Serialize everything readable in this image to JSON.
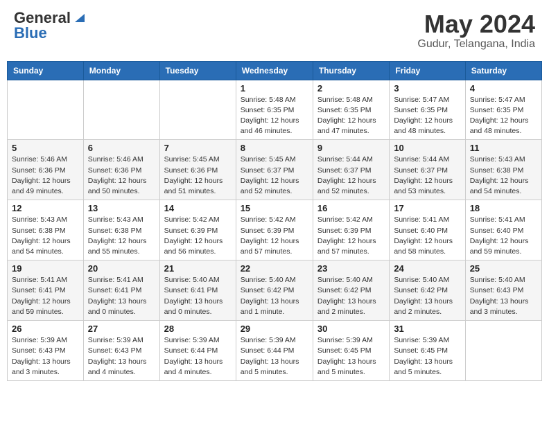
{
  "logo": {
    "general": "General",
    "blue": "Blue"
  },
  "header": {
    "month_year": "May 2024",
    "location": "Gudur, Telangana, India"
  },
  "days_of_week": [
    "Sunday",
    "Monday",
    "Tuesday",
    "Wednesday",
    "Thursday",
    "Friday",
    "Saturday"
  ],
  "weeks": [
    [
      {
        "day": "",
        "info": ""
      },
      {
        "day": "",
        "info": ""
      },
      {
        "day": "",
        "info": ""
      },
      {
        "day": "1",
        "info": "Sunrise: 5:48 AM\nSunset: 6:35 PM\nDaylight: 12 hours\nand 46 minutes."
      },
      {
        "day": "2",
        "info": "Sunrise: 5:48 AM\nSunset: 6:35 PM\nDaylight: 12 hours\nand 47 minutes."
      },
      {
        "day": "3",
        "info": "Sunrise: 5:47 AM\nSunset: 6:35 PM\nDaylight: 12 hours\nand 48 minutes."
      },
      {
        "day": "4",
        "info": "Sunrise: 5:47 AM\nSunset: 6:35 PM\nDaylight: 12 hours\nand 48 minutes."
      }
    ],
    [
      {
        "day": "5",
        "info": "Sunrise: 5:46 AM\nSunset: 6:36 PM\nDaylight: 12 hours\nand 49 minutes."
      },
      {
        "day": "6",
        "info": "Sunrise: 5:46 AM\nSunset: 6:36 PM\nDaylight: 12 hours\nand 50 minutes."
      },
      {
        "day": "7",
        "info": "Sunrise: 5:45 AM\nSunset: 6:36 PM\nDaylight: 12 hours\nand 51 minutes."
      },
      {
        "day": "8",
        "info": "Sunrise: 5:45 AM\nSunset: 6:37 PM\nDaylight: 12 hours\nand 52 minutes."
      },
      {
        "day": "9",
        "info": "Sunrise: 5:44 AM\nSunset: 6:37 PM\nDaylight: 12 hours\nand 52 minutes."
      },
      {
        "day": "10",
        "info": "Sunrise: 5:44 AM\nSunset: 6:37 PM\nDaylight: 12 hours\nand 53 minutes."
      },
      {
        "day": "11",
        "info": "Sunrise: 5:43 AM\nSunset: 6:38 PM\nDaylight: 12 hours\nand 54 minutes."
      }
    ],
    [
      {
        "day": "12",
        "info": "Sunrise: 5:43 AM\nSunset: 6:38 PM\nDaylight: 12 hours\nand 54 minutes."
      },
      {
        "day": "13",
        "info": "Sunrise: 5:43 AM\nSunset: 6:38 PM\nDaylight: 12 hours\nand 55 minutes."
      },
      {
        "day": "14",
        "info": "Sunrise: 5:42 AM\nSunset: 6:39 PM\nDaylight: 12 hours\nand 56 minutes."
      },
      {
        "day": "15",
        "info": "Sunrise: 5:42 AM\nSunset: 6:39 PM\nDaylight: 12 hours\nand 57 minutes."
      },
      {
        "day": "16",
        "info": "Sunrise: 5:42 AM\nSunset: 6:39 PM\nDaylight: 12 hours\nand 57 minutes."
      },
      {
        "day": "17",
        "info": "Sunrise: 5:41 AM\nSunset: 6:40 PM\nDaylight: 12 hours\nand 58 minutes."
      },
      {
        "day": "18",
        "info": "Sunrise: 5:41 AM\nSunset: 6:40 PM\nDaylight: 12 hours\nand 59 minutes."
      }
    ],
    [
      {
        "day": "19",
        "info": "Sunrise: 5:41 AM\nSunset: 6:41 PM\nDaylight: 12 hours\nand 59 minutes."
      },
      {
        "day": "20",
        "info": "Sunrise: 5:41 AM\nSunset: 6:41 PM\nDaylight: 13 hours\nand 0 minutes."
      },
      {
        "day": "21",
        "info": "Sunrise: 5:40 AM\nSunset: 6:41 PM\nDaylight: 13 hours\nand 0 minutes."
      },
      {
        "day": "22",
        "info": "Sunrise: 5:40 AM\nSunset: 6:42 PM\nDaylight: 13 hours\nand 1 minute."
      },
      {
        "day": "23",
        "info": "Sunrise: 5:40 AM\nSunset: 6:42 PM\nDaylight: 13 hours\nand 2 minutes."
      },
      {
        "day": "24",
        "info": "Sunrise: 5:40 AM\nSunset: 6:42 PM\nDaylight: 13 hours\nand 2 minutes."
      },
      {
        "day": "25",
        "info": "Sunrise: 5:40 AM\nSunset: 6:43 PM\nDaylight: 13 hours\nand 3 minutes."
      }
    ],
    [
      {
        "day": "26",
        "info": "Sunrise: 5:39 AM\nSunset: 6:43 PM\nDaylight: 13 hours\nand 3 minutes."
      },
      {
        "day": "27",
        "info": "Sunrise: 5:39 AM\nSunset: 6:43 PM\nDaylight: 13 hours\nand 4 minutes."
      },
      {
        "day": "28",
        "info": "Sunrise: 5:39 AM\nSunset: 6:44 PM\nDaylight: 13 hours\nand 4 minutes."
      },
      {
        "day": "29",
        "info": "Sunrise: 5:39 AM\nSunset: 6:44 PM\nDaylight: 13 hours\nand 5 minutes."
      },
      {
        "day": "30",
        "info": "Sunrise: 5:39 AM\nSunset: 6:45 PM\nDaylight: 13 hours\nand 5 minutes."
      },
      {
        "day": "31",
        "info": "Sunrise: 5:39 AM\nSunset: 6:45 PM\nDaylight: 13 hours\nand 5 minutes."
      },
      {
        "day": "",
        "info": ""
      }
    ]
  ]
}
